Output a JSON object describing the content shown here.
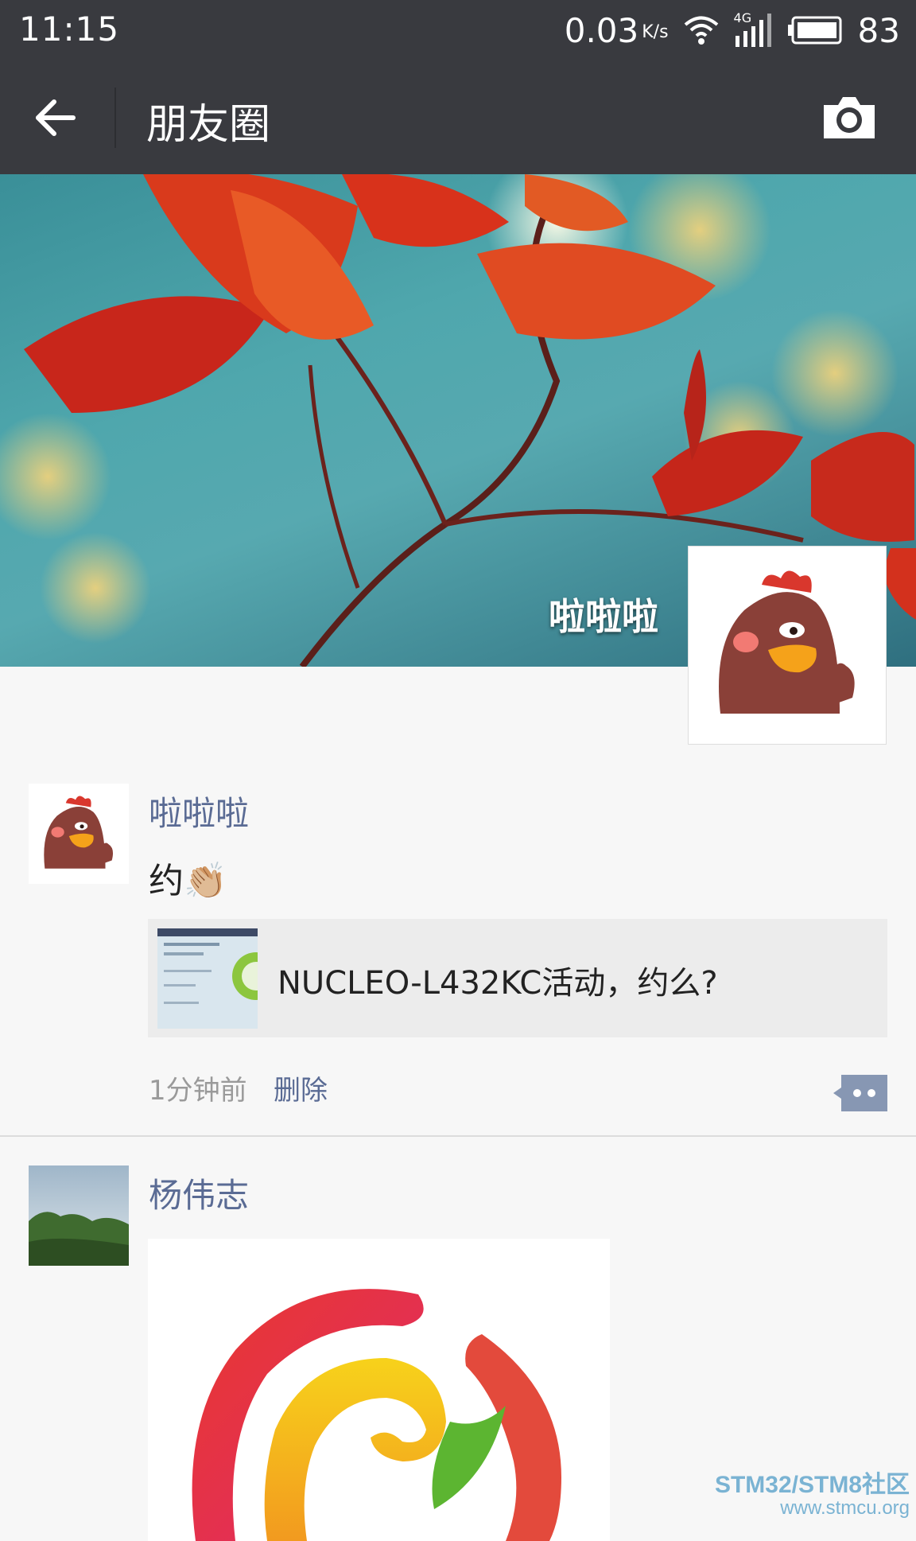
{
  "status_bar": {
    "time": "11:15",
    "net_speed": "0.03",
    "net_unit": "K/s",
    "signal_type": "4G",
    "battery": "83"
  },
  "nav": {
    "title": "朋友圈",
    "back_icon": "arrow-left-icon",
    "camera_icon": "camera-icon"
  },
  "cover": {
    "user_name": "啦啦啦"
  },
  "posts": [
    {
      "author": "啦啦啦",
      "text": "约",
      "emoji": "👏🏼",
      "link_title": "NUCLEO-L432KC活动，约么?",
      "time": "1分钟前",
      "delete_label": "删除"
    },
    {
      "author": "杨伟志"
    }
  ],
  "watermark": {
    "line1": "STM32/STM8社区",
    "line2": "www.stmcu.org"
  },
  "colors": {
    "bar": "#393a3f",
    "link_blue": "#5a6b94",
    "background": "#f7f7f7"
  }
}
